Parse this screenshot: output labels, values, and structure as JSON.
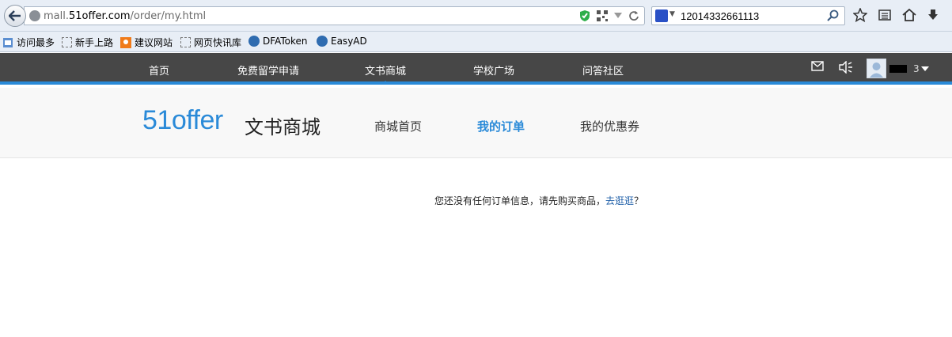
{
  "browser": {
    "url_prefix": "mall.",
    "url_host": "51offer.com",
    "url_path": "/order/my.html",
    "search_value": "12014332661113"
  },
  "bookmarks": [
    {
      "label": "访问最多",
      "icon": "bookmark-folder-icon"
    },
    {
      "label": "新手上路",
      "icon": "page-icon"
    },
    {
      "label": "建议网站",
      "icon": "suggest-icon"
    },
    {
      "label": "网页快讯库",
      "icon": "page-icon"
    },
    {
      "label": "DFAToken",
      "icon": "site-icon"
    },
    {
      "label": "EasyAD",
      "icon": "site-icon"
    }
  ],
  "site_nav": {
    "items": [
      "首页",
      "免费留学申请",
      "文书商城",
      "学校广场",
      "问答社区"
    ],
    "active": "文书商城",
    "username_suffix": "3"
  },
  "subheader": {
    "logo": "51offer",
    "title": "文书商城",
    "links": [
      "商城首页",
      "我的订单",
      "我的优惠券"
    ],
    "active": "我的订单"
  },
  "empty_state": {
    "message": "您还没有任何订单信息，请先购买商品，",
    "link_text": "去逛逛",
    "suffix": "？"
  },
  "colors": {
    "accent": "#2a8ad8",
    "nav_bg": "#474747",
    "logo_dot": "#f39800"
  }
}
